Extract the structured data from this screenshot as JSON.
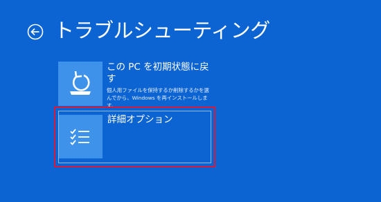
{
  "page": {
    "title": "トラブルシューティング",
    "background_color": "#0c64d3"
  },
  "back_button": {
    "icon": "arrow-left-circle-icon"
  },
  "options": [
    {
      "id": "reset-pc",
      "title": "この PC を初期状態に戻す",
      "description": "個人用ファイルを保持するか削除するかを選んでから、Windows を再インストールします。",
      "icon": "pc-reset-icon",
      "selected": false
    },
    {
      "id": "advanced-options",
      "title": "詳細オプション",
      "description": "",
      "icon": "checklist-icon",
      "selected": true
    }
  ],
  "highlight_color": "#d7193a",
  "tile_color": "#3e92ea"
}
